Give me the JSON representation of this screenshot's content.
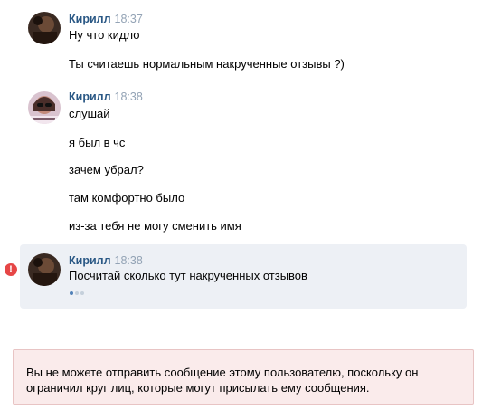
{
  "messages": [
    {
      "author": "Кирилл",
      "time": "18:37",
      "lines": [
        "Ну что кидло",
        "Ты считаешь нормальным накрученные отзывы ?)"
      ]
    },
    {
      "author": "Кирилл",
      "time": "18:38",
      "lines": [
        "слушай",
        "я был в чс",
        "зачем убрал?",
        "там комфортно было",
        "из-за тебя не могу сменить имя"
      ]
    },
    {
      "author": "Кирилл",
      "time": "18:38",
      "lines": [
        "Посчитай сколько тут накрученных отзывов"
      ],
      "status": "failed"
    }
  ],
  "error_icon": "!",
  "notice": {
    "text": "Вы не можете отправить сообщение этому пользователю, поскольку он ограничил круг лиц, которые могут присылать ему сообщения."
  },
  "colors": {
    "author": "#2a5885",
    "time": "#93a3b5",
    "failed_bg": "#edf0f5",
    "error": "#e64646",
    "notice_bg": "#faebeb"
  }
}
